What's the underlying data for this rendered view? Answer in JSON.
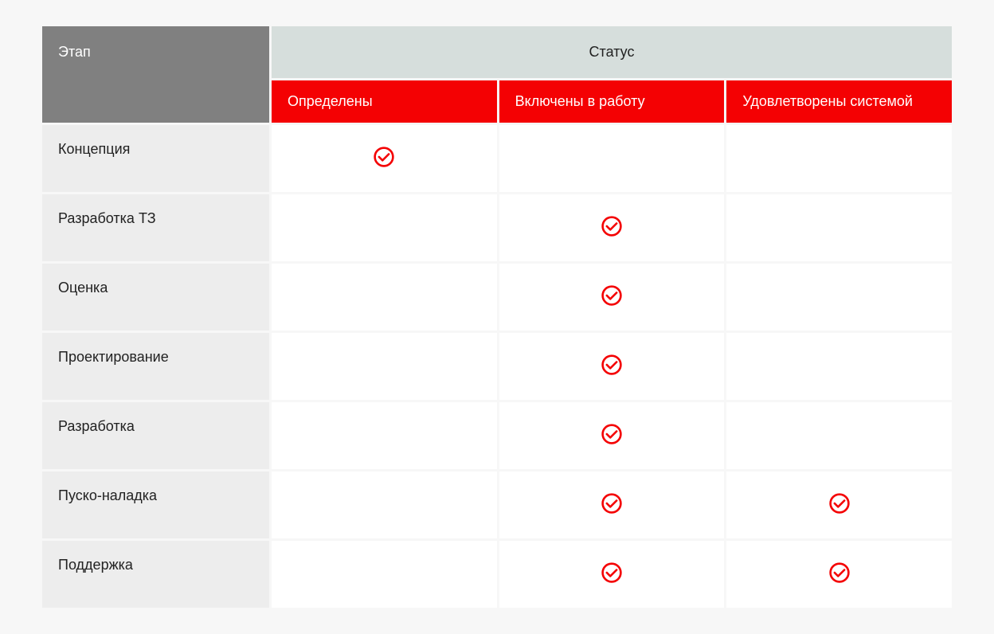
{
  "colors": {
    "accent": "#f40103",
    "status_header": "#d6dedc",
    "stage_header": "#808080",
    "row_head": "#ededed",
    "white": "#ffffff",
    "bg": "#f7f7f7"
  },
  "table": {
    "stage_header": "Этап",
    "status_header": "Статус",
    "status_columns": [
      "Определены",
      "Включены в работу",
      "Удовлетворены системой"
    ],
    "rows": [
      {
        "stage": "Концепция",
        "checks": [
          true,
          false,
          false
        ]
      },
      {
        "stage": "Разработка ТЗ",
        "checks": [
          false,
          true,
          false
        ]
      },
      {
        "stage": "Оценка",
        "checks": [
          false,
          true,
          false
        ]
      },
      {
        "stage": "Проектирование",
        "checks": [
          false,
          true,
          false
        ]
      },
      {
        "stage": "Разработка",
        "checks": [
          false,
          true,
          false
        ]
      },
      {
        "stage": "Пуско-наладка",
        "checks": [
          false,
          true,
          true
        ]
      },
      {
        "stage": "Поддержка",
        "checks": [
          false,
          true,
          true
        ]
      }
    ]
  }
}
